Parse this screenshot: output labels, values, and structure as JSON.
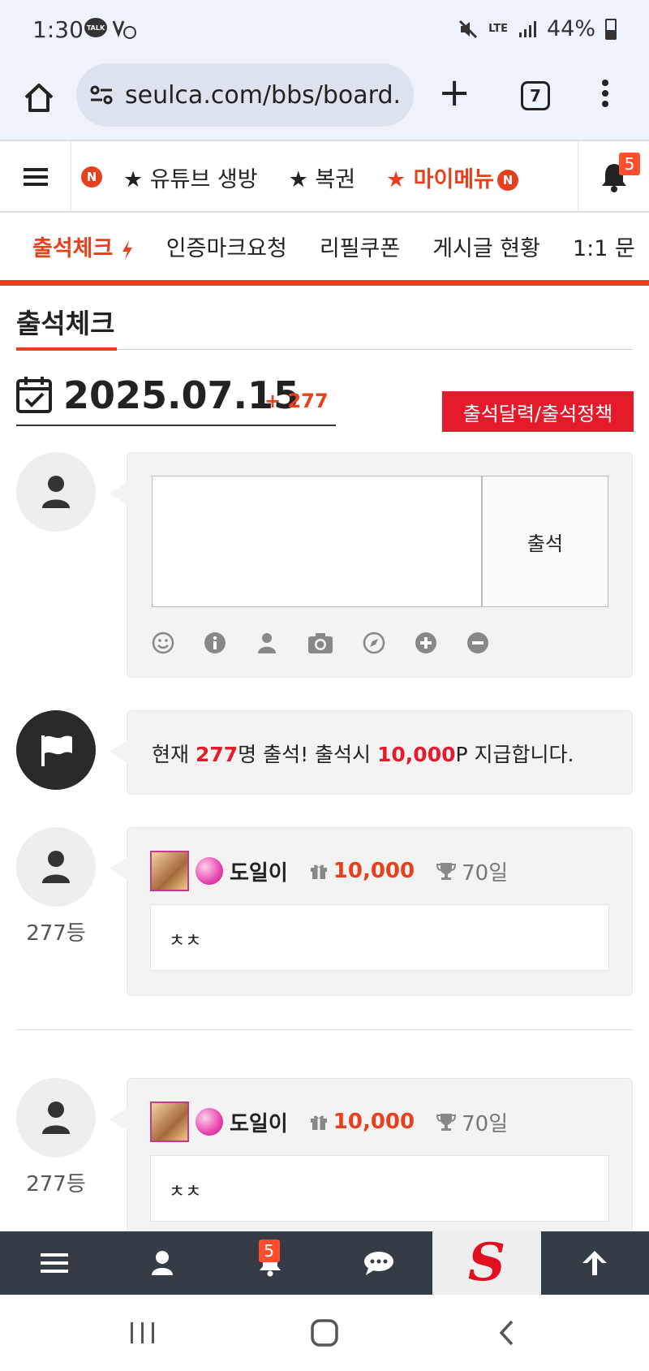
{
  "status": {
    "time": "1:30",
    "network": "LTE",
    "battery": "44%"
  },
  "browser": {
    "url": "seulca.com/bbs/board.p",
    "tab_count": "7"
  },
  "site_nav": {
    "items": [
      {
        "label": "★ 유튜브 생방"
      },
      {
        "label": "★ 복권"
      },
      {
        "label": "★ 마이메뉴"
      }
    ],
    "new_badge": "N",
    "notification_count": "5"
  },
  "sub_menu": {
    "items": [
      {
        "label": "출석체크"
      },
      {
        "label": "인증마크요청"
      },
      {
        "label": "리필쿠폰"
      },
      {
        "label": "게시글 현황"
      },
      {
        "label": "1:1 문"
      }
    ]
  },
  "page": {
    "title": "출석체크",
    "date": "2025.07.15",
    "count": "+ 277",
    "policy_button": "출석달력/출석정책"
  },
  "form": {
    "textarea_placeholder": "",
    "submit_label": "출석"
  },
  "notice": {
    "prefix": "현재 ",
    "count": "277",
    "middle": "명 출석! 출석시 ",
    "points": "10,000",
    "suffix": "P 지급합니다."
  },
  "entries": [
    {
      "rank": "277등",
      "nickname": "도일이",
      "points": "10,000",
      "days": "70일",
      "comment": "ㅊㅊ"
    },
    {
      "rank": "277등",
      "nickname": "도일이",
      "points": "10,000",
      "days": "70일",
      "comment": "ㅊㅊ"
    }
  ],
  "bottom_bar": {
    "notification_count": "5",
    "logo_letter": "S"
  },
  "colors": {
    "accent": "#e8401c",
    "button_red": "#e51b2c",
    "bottom_bar_bg": "#363c45"
  }
}
